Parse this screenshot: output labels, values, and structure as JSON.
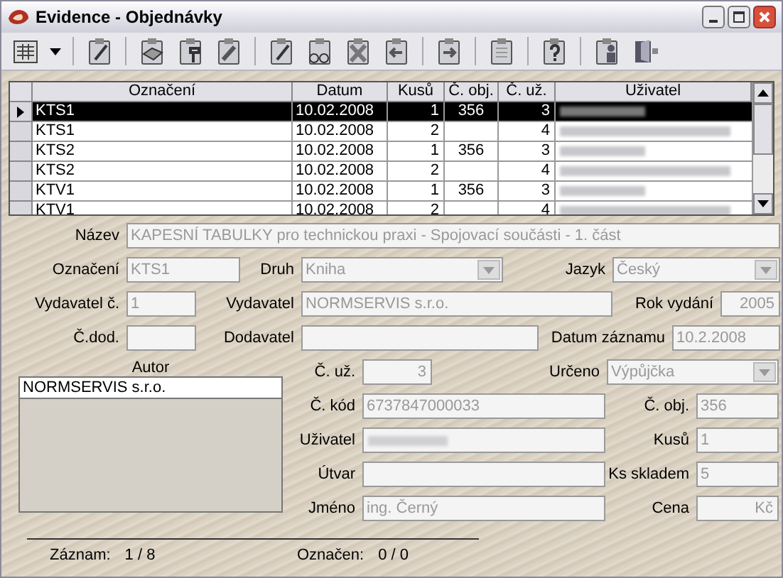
{
  "window": {
    "title": "Evidence - Objednávky"
  },
  "table": {
    "columns": [
      "Označení",
      "Datum",
      "Kusů",
      "Č. obj.",
      "Č. už.",
      "Uživatel"
    ],
    "rows": [
      {
        "cells": [
          "KTS1",
          "10.02.2008",
          "1",
          "356",
          "3"
        ],
        "user_redacted": true,
        "selected": true
      },
      {
        "cells": [
          "KTS1",
          "10.02.2008",
          "2",
          "",
          "4"
        ],
        "user_redacted": true,
        "selected": false
      },
      {
        "cells": [
          "KTS2",
          "10.02.2008",
          "1",
          "356",
          "3"
        ],
        "user_redacted": true,
        "selected": false
      },
      {
        "cells": [
          "KTS2",
          "10.02.2008",
          "2",
          "",
          "4"
        ],
        "user_redacted": true,
        "selected": false
      },
      {
        "cells": [
          "KTV1",
          "10.02.2008",
          "1",
          "356",
          "3"
        ],
        "user_redacted": true,
        "selected": false
      },
      {
        "cells": [
          "KTV1",
          "10.02.2008",
          "2",
          "",
          "4"
        ],
        "user_redacted": true,
        "selected": false
      }
    ]
  },
  "form": {
    "fields": [
      {
        "label": "Název",
        "value": "KAPESNÍ TABULKY pro technickou praxi - Spojovací součásti - 1. část",
        "kind": "text"
      },
      {
        "label": "Označení",
        "value": "KTS1",
        "kind": "text"
      },
      {
        "label": "Druh",
        "value": "Kniha",
        "kind": "combo"
      },
      {
        "label": "Jazyk",
        "value": "Český",
        "kind": "combo"
      },
      {
        "label": "Vydavatel č.",
        "value": "1",
        "kind": "text"
      },
      {
        "label": "Vydavatel",
        "value": "NORMSERVIS s.r.o.",
        "kind": "text"
      },
      {
        "label": "Rok vydání",
        "value": "2005",
        "kind": "text"
      },
      {
        "label": "Č.dod.",
        "kind": "text"
      },
      {
        "label": "Dodavatel",
        "kind": "text"
      },
      {
        "label": "Datum záznamu",
        "value": "10.2.2008",
        "kind": "text"
      }
    ]
  },
  "autor": {
    "label": "Autor",
    "items": [
      "NORMSERVIS s.r.o."
    ]
  },
  "details": {
    "fields": [
      {
        "label": "Č. už.",
        "value": "3",
        "kind": "text"
      },
      {
        "label": "Určeno",
        "value": "Výpůjčka",
        "kind": "combo"
      },
      {
        "label": "Č. kód",
        "value": "6737847000033",
        "kind": "text"
      },
      {
        "label": "Č. obj.",
        "value": "356",
        "kind": "text"
      },
      {
        "label": "Uživatel",
        "kind": "redacted"
      },
      {
        "label": "Kusů",
        "value": "1",
        "kind": "text"
      },
      {
        "label": "Útvar",
        "kind": "text"
      },
      {
        "label": "Ks skladem",
        "value": "5",
        "kind": "text"
      },
      {
        "label": "Jméno",
        "value": "ing. Černý",
        "kind": "text"
      },
      {
        "label": "Cena",
        "value": "Kč",
        "kind": "text"
      }
    ]
  },
  "status_bar": [
    {
      "label": "Záznam:",
      "value": "1 / 8"
    },
    {
      "label": "Označen:",
      "value": "0 / 0"
    }
  ]
}
